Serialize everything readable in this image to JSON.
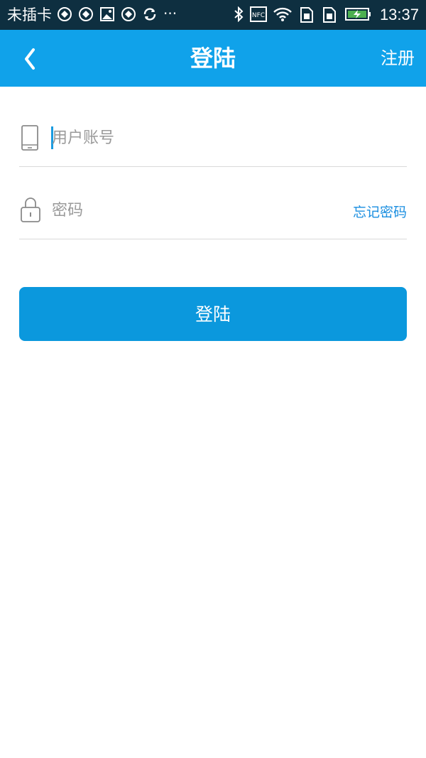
{
  "status_bar": {
    "carrier": "未插卡",
    "more": "···",
    "time": "13:37",
    "icons": [
      "notification-icon",
      "notification-icon",
      "image-icon",
      "notification-icon",
      "sync-icon",
      "bluetooth-icon",
      "nfc-icon",
      "wifi-icon",
      "sim-icon",
      "sim-icon",
      "battery-charging-icon"
    ]
  },
  "app_bar": {
    "title": "登陆",
    "back_icon": "chevron-left-icon",
    "register_label": "注册"
  },
  "form": {
    "account": {
      "icon": "phone-icon",
      "placeholder": "用户账号",
      "value": ""
    },
    "password": {
      "icon": "lock-icon",
      "placeholder": "密码",
      "value": "",
      "forgot_label": "忘记密码"
    },
    "login_label": "登陆"
  },
  "colors": {
    "status_bar": "#0e2f40",
    "app_bar": "#10a2ea",
    "button": "#0b98dd",
    "link": "#1a8ee0",
    "divider": "#d9d9d9"
  }
}
